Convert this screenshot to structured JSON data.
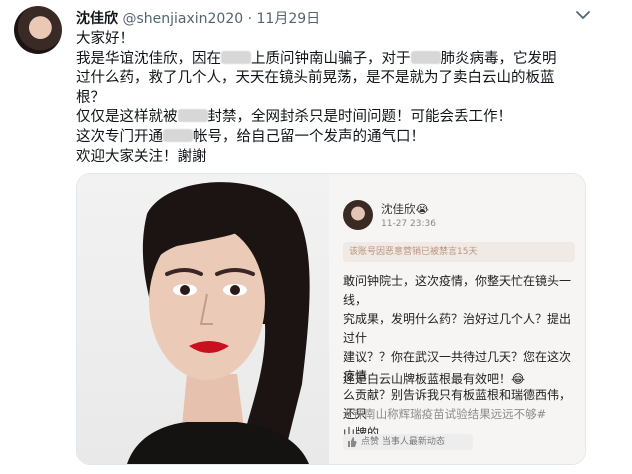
{
  "tweet": {
    "author_name": "沈佳欣",
    "handle": "@shenjiaxin2020",
    "separator": "·",
    "date": "11月29日",
    "more_icon": "chevron-down-icon",
    "lines": {
      "l1": "大家好！",
      "l2a": "我是华谊沈佳欣，因在",
      "l2b": "上质问钟南山骗子，对于",
      "l2c": "肺炎病毒，它发明",
      "l3": "过什么药，救了几个人，天天在镜头前晃荡，是不是就为了卖白云山的板蓝",
      "l4": "根？",
      "l5a": "仅仅是这样就被",
      "l5b": "封禁，全网封杀只是时间问题！可能会丢工作！",
      "l6a": "这次专门开通",
      "l6b": "帐号，给自己留一个发声的通气口！",
      "l7": "欢迎大家关注！謝謝"
    }
  },
  "screenshot": {
    "name": "沈佳欣",
    "name_badge": "😭",
    "time": "11-27 23:36",
    "notice": "该账号因恶意营销已被禁言15天",
    "body_lines": [
      "敢问钟院士，这次疫情，你整天忙在镜头一线，",
      "究成果，发明什么药？治好过几个人？提出过什",
      "建议？？你在武汉一共待过几天？您在这次疫情",
      "么贡献？别告诉我只有板蓝根和瑞德西伟，还只",
      "山牌的。"
    ],
    "line2": "还是白云山牌板蓝根最有效吧！😂",
    "hashtag": "#钟南山称辉瑞疫苗试验结果远远不够#",
    "like_text": "点赞 当事人最新动态"
  },
  "colors": {
    "text": "#0f1419",
    "muted": "#536471",
    "lipstick": "#c8101e"
  }
}
